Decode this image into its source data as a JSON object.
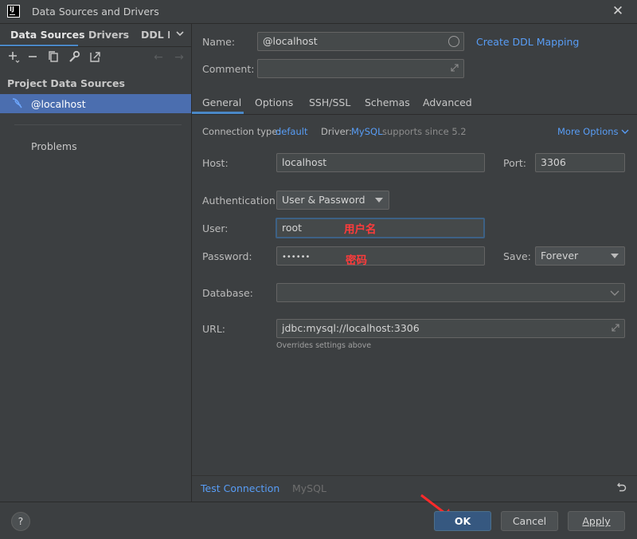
{
  "window": {
    "title": "Data Sources and Drivers",
    "logo_text": "IJ"
  },
  "left": {
    "tabs": [
      "Data Sources",
      "Drivers",
      "DDL M"
    ],
    "section_title": "Project Data Sources",
    "data_source": "@localhost",
    "problems": "Problems"
  },
  "form": {
    "name_label": "Name:",
    "name_value": "@localhost",
    "create_ddl": "Create DDL Mapping",
    "comment_label": "Comment:",
    "tabs": [
      "General",
      "Options",
      "SSH/SSL",
      "Schemas",
      "Advanced"
    ],
    "conn_type_label": "Connection type:",
    "conn_type_value": "default",
    "driver_label": "Driver:",
    "driver_value": "MySQL",
    "driver_note": "supports since 5.2",
    "more_options": "More Options",
    "host_label": "Host:",
    "host_value": "localhost",
    "port_label": "Port:",
    "port_value": "3306",
    "auth_label": "Authentication:",
    "auth_value": "User & Password",
    "user_label": "User:",
    "user_value": "root",
    "user_annotation": "用户名",
    "password_label": "Password:",
    "password_value": "••••••",
    "password_annotation": "密码",
    "save_label": "Save:",
    "save_value": "Forever",
    "database_label": "Database:",
    "database_value": "",
    "url_label": "URL:",
    "url_value": "jdbc:mysql://localhost:3306",
    "url_note": "Overrides settings above",
    "test_connection": "Test Connection",
    "driver_footer": "MySQL"
  },
  "footer": {
    "help": "?",
    "ok": "OK",
    "cancel": "Cancel",
    "apply": "Apply"
  },
  "colors": {
    "accent": "#4a88c7",
    "selection": "#4b6eaf",
    "link": "#589df6",
    "annotation": "#ff3b3b"
  }
}
